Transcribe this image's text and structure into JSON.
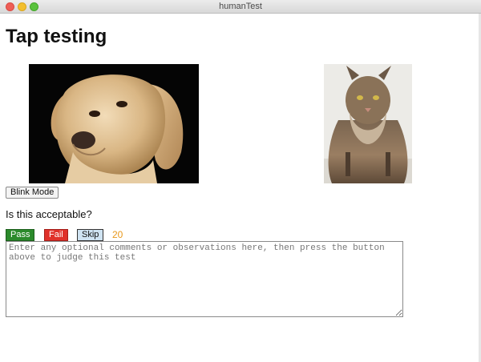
{
  "window": {
    "title": "humanTest"
  },
  "page": {
    "title": "Tap testing"
  },
  "images": [
    {
      "name": "dog-photo",
      "subject": "labrador dog"
    },
    {
      "name": "cat-photo",
      "subject": "maine coon cat"
    }
  ],
  "controls": {
    "blink_label": "Blink Mode",
    "question": "Is this acceptable?",
    "pass_label": "Pass",
    "fail_label": "Fail",
    "skip_label": "Skip",
    "count": "20"
  },
  "comments": {
    "value": "",
    "placeholder": "Enter any optional comments or observations here, then press the button above to judge this test"
  },
  "colors": {
    "pass": "#2b8a2b",
    "fail": "#e0312a",
    "skip": "#cfe3f2",
    "count": "#e8981c"
  }
}
